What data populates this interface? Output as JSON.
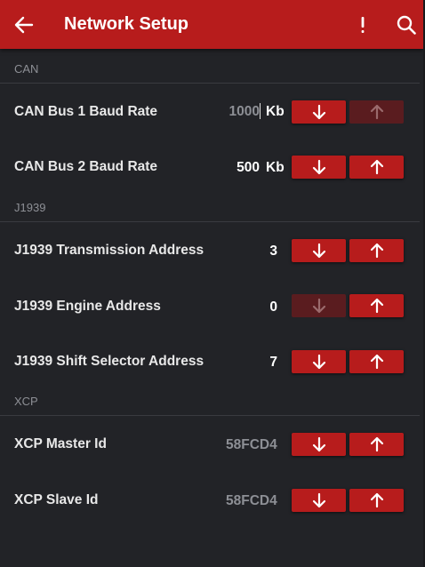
{
  "appbar": {
    "title": "Network Setup",
    "icons": [
      "back-arrow-icon",
      "alert-icon",
      "search-icon"
    ]
  },
  "sections": {
    "can": {
      "header": "CAN",
      "rows": [
        {
          "label": "CAN Bus 1 Baud Rate",
          "value": "1000",
          "unit": "Kb",
          "down_enabled": true,
          "up_enabled": false,
          "editing": true
        },
        {
          "label": "CAN Bus 2 Baud Rate",
          "value": "500",
          "unit": "Kb",
          "down_enabled": true,
          "up_enabled": true
        }
      ]
    },
    "j1939": {
      "header": "J1939",
      "rows": [
        {
          "label": "J1939 Transmission Address",
          "value": "3",
          "down_enabled": true,
          "up_enabled": true
        },
        {
          "label": "J1939 Engine Address",
          "value": "0",
          "down_enabled": false,
          "up_enabled": true
        },
        {
          "label": "J1939 Shift Selector Address",
          "value": "7",
          "down_enabled": true,
          "up_enabled": true
        }
      ]
    },
    "xcp": {
      "header": "XCP",
      "rows": [
        {
          "label": "XCP Master Id",
          "value": "58FCD4",
          "down_enabled": true,
          "up_enabled": true
        },
        {
          "label": "XCP Slave Id",
          "value": "58FCD4",
          "down_enabled": true,
          "up_enabled": true
        }
      ]
    }
  },
  "colors": {
    "accent": "#b71c1c",
    "accent_disabled": "#5a1c1f",
    "background": "#222327",
    "section_text": "#8d8f95"
  }
}
